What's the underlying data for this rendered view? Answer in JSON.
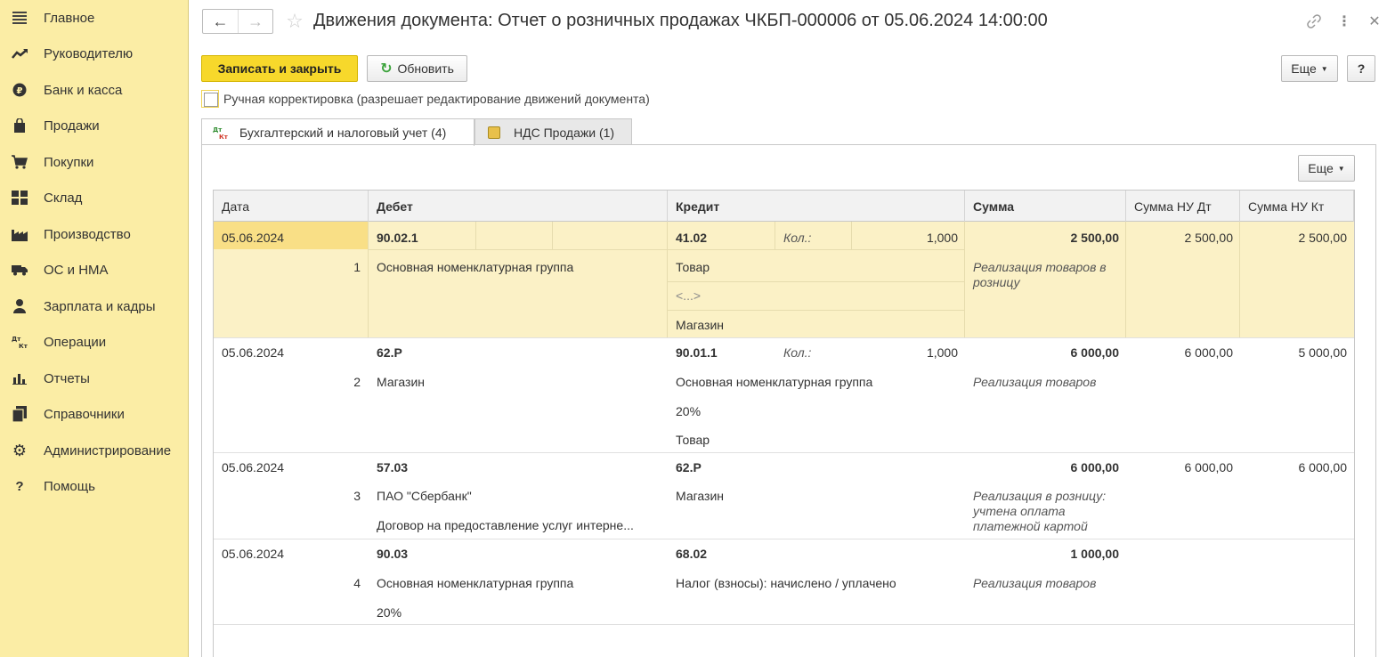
{
  "sidebar": {
    "items": [
      {
        "label": "Главное",
        "icon": "menu-icon"
      },
      {
        "label": "Руководителю",
        "icon": "trend-icon"
      },
      {
        "label": "Банк и касса",
        "icon": "coin-icon"
      },
      {
        "label": "Продажи",
        "icon": "bag-icon"
      },
      {
        "label": "Покупки",
        "icon": "cart-icon"
      },
      {
        "label": "Склад",
        "icon": "warehouse-icon"
      },
      {
        "label": "Производство",
        "icon": "factory-icon"
      },
      {
        "label": "ОС и НМА",
        "icon": "truck-icon"
      },
      {
        "label": "Зарплата и кадры",
        "icon": "person-icon"
      },
      {
        "label": "Операции",
        "icon": "dt-kt-icon"
      },
      {
        "label": "Отчеты",
        "icon": "bar-chart-icon"
      },
      {
        "label": "Справочники",
        "icon": "books-icon"
      },
      {
        "label": "Администрирование",
        "icon": "gear-icon"
      },
      {
        "label": "Помощь",
        "icon": "question-icon"
      }
    ]
  },
  "header": {
    "title": "Движения документа: Отчет о розничных продажах ЧКБП-000006 от 05.06.2024 14:00:00",
    "back": "←",
    "forward": "→",
    "star": "☆",
    "link": "🔗",
    "more": "⋮",
    "close": "✕"
  },
  "toolbar": {
    "save_close": "Записать и закрыть",
    "refresh": "Обновить",
    "more": "Еще",
    "help": "?"
  },
  "manual_edit": {
    "label": "Ручная корректировка (разрешает редактирование движений документа)",
    "checked": false
  },
  "tabs": [
    {
      "label": "Бухгалтерский и налоговый учет (4)",
      "icon": "dt-kt-icon",
      "active": true
    },
    {
      "label": "НДС Продажи (1)",
      "icon": "register-icon",
      "active": false
    }
  ],
  "panel": {
    "more": "Еще"
  },
  "table": {
    "columns": [
      "Дата",
      "Дебет",
      "Кредит",
      "Сумма",
      "Сумма НУ Дт",
      "Сумма НУ Кт"
    ],
    "qty_label": "Кол.:",
    "rows": [
      {
        "date": "05.06.2024",
        "num": "1",
        "debit_account": "90.02.1",
        "debit_sub": [
          "Основная номенклатурная группа"
        ],
        "credit_account": "41.02",
        "qty": "1,000",
        "credit_sub": [
          "Товар",
          "<...>",
          "Магазин"
        ],
        "sum": "2 500,00",
        "content": "Реализация товаров в розницу",
        "sum_nu_dt": "2 500,00",
        "sum_nu_kt": "2 500,00"
      },
      {
        "date": "05.06.2024",
        "num": "2",
        "debit_account": "62.Р",
        "debit_sub": [
          "Магазин"
        ],
        "credit_account": "90.01.1",
        "qty": "1,000",
        "credit_sub": [
          "Основная номенклатурная группа",
          "20%",
          "Товар"
        ],
        "sum": "6 000,00",
        "content": "Реализация товаров",
        "sum_nu_dt": "6 000,00",
        "sum_nu_kt": "5 000,00"
      },
      {
        "date": "05.06.2024",
        "num": "3",
        "debit_account": "57.03",
        "debit_sub": [
          "ПАО \"Сбербанк\"",
          "Договор на предоставление услуг интерне..."
        ],
        "credit_account": "62.Р",
        "qty": "",
        "credit_sub": [
          "Магазин"
        ],
        "sum": "6 000,00",
        "content": "Реализация в розницу: учтена оплата платежной картой",
        "sum_nu_dt": "6 000,00",
        "sum_nu_kt": "6 000,00"
      },
      {
        "date": "05.06.2024",
        "num": "4",
        "debit_account": "90.03",
        "debit_sub": [
          "Основная номенклатурная группа",
          "20%"
        ],
        "credit_account": "68.02",
        "qty": "",
        "credit_sub": [
          "Налог (взносы): начислено / уплачено"
        ],
        "sum": "1 000,00",
        "content": "Реализация товаров",
        "sum_nu_dt": "",
        "sum_nu_kt": ""
      }
    ]
  },
  "colors": {
    "sidebar_bg": "#fbeda5",
    "selected_row": "#fbf1c6",
    "primary_button": "#f7d82b",
    "refresh_icon": "#3ca33c"
  }
}
